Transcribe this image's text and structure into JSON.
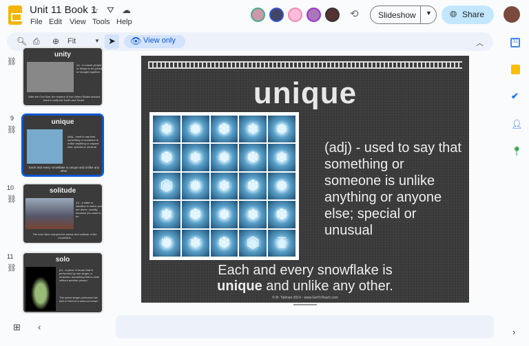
{
  "app": {
    "title": "Unit 11 Book 1",
    "menu": [
      "File",
      "Edit",
      "View",
      "Tools",
      "Help"
    ]
  },
  "toolbar": {
    "zoom_value": "Fit",
    "view_only": "View only"
  },
  "header": {
    "slideshow": "Slideshow",
    "share": "Share"
  },
  "filmstrip": [
    {
      "number": "",
      "title": "unity",
      "definition": "(v) - to cause people or things to be joined or brought together",
      "sentence": "After the Civil War, the leaders of the United States worked hard to unify the North and South."
    },
    {
      "number": "9",
      "title": "unique",
      "definition": "(adj) - used to say that something or someone is unlike anything or anyone else; special or unusual",
      "sentence": "Each and every snowflake is unique and unlike any other."
    },
    {
      "number": "10",
      "title": "solitude",
      "definition": "(n) - a state or situation in which you are alone, usually because you want to be",
      "sentence": "The lone hiker enjoyed the peace and solitude of the mountains."
    },
    {
      "number": "11",
      "title": "solo",
      "definition": "(n) - a piece of music that is performed by one singer or musician; something that is done without another person",
      "sentence": "The opera singer performed her solo in front of a sold-out crowd."
    }
  ],
  "slide": {
    "title": "unique",
    "definition": "(adj) - used to say that something or someone is unlike anything or anyone else; special or unusual",
    "sentence_line1": "Each and every snowflake is",
    "sentence_bold": "unique",
    "sentence_rest": " and unlike any other.",
    "credit": "© M. Tallman 2014 - www.GetToTeach.com"
  },
  "colors": {
    "accent": "#0b57d0",
    "share_bg": "#c2e7ff",
    "toolbar_bg": "#edf2fa",
    "slide_bg": "#3a3a3a"
  }
}
